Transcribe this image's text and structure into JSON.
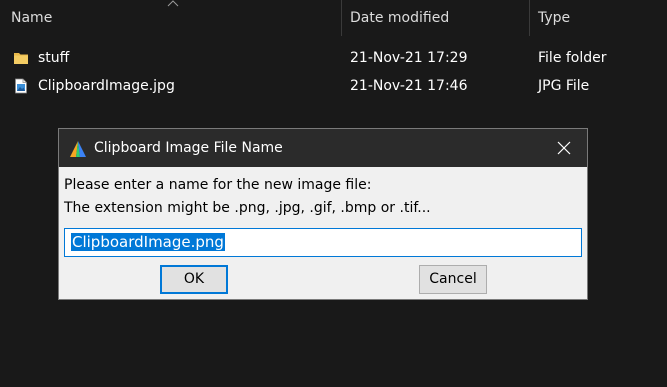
{
  "explorer": {
    "columns": {
      "name": "Name",
      "date_modified": "Date modified",
      "type": "Type"
    },
    "rows": [
      {
        "name": "stuff",
        "date": "21-Nov-21 17:29",
        "type": "File folder",
        "icon": "folder-icon"
      },
      {
        "name": "ClipboardImage.jpg",
        "date": "21-Nov-21 17:46",
        "type": "JPG File",
        "icon": "image-file-icon"
      }
    ]
  },
  "dialog": {
    "title": "Clipboard Image File Name",
    "prompt_line1": "Please enter a name for the new image file:",
    "prompt_line2": "The extension might be .png, .jpg, .gif, .bmp or .tif...",
    "input_value": "ClipboardImage.png",
    "ok_label": "OK",
    "cancel_label": "Cancel"
  },
  "colors": {
    "background": "#191919",
    "dialog_bg": "#f0f0f0",
    "titlebar": "#2b2b2b",
    "accent": "#0078d7",
    "folder": "#e8b84a"
  }
}
